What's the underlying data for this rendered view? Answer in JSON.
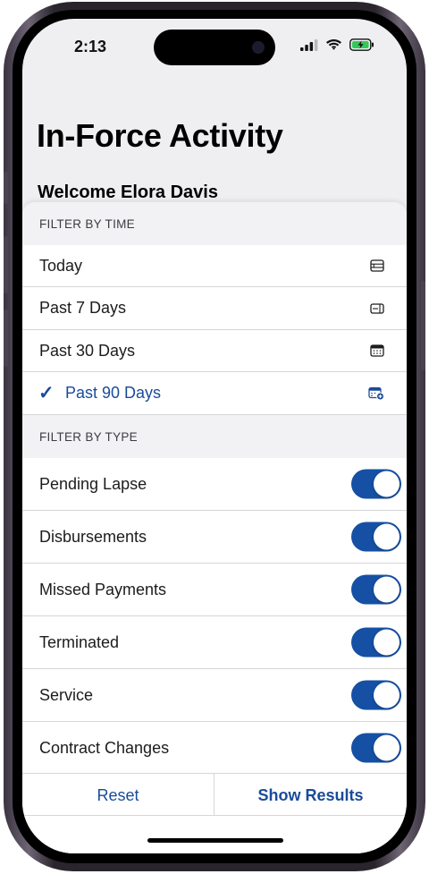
{
  "status_bar": {
    "time": "2:13"
  },
  "header": {
    "title": "In-Force Activity",
    "welcome": "Welcome Elora Davis"
  },
  "filter_time": {
    "header": "FILTER BY TIME",
    "items": [
      {
        "label": "Today",
        "icon": "calendar-day-icon",
        "selected": false
      },
      {
        "label": "Past 7 Days",
        "icon": "calendar-week-icon",
        "selected": false
      },
      {
        "label": "Past 30 Days",
        "icon": "calendar-month-icon",
        "selected": false
      },
      {
        "label": "Past 90 Days",
        "icon": "calendar-add-icon",
        "selected": true
      }
    ]
  },
  "filter_type": {
    "header": "FILTER BY TYPE",
    "items": [
      {
        "label": "Pending Lapse",
        "on": true
      },
      {
        "label": "Disbursements",
        "on": true
      },
      {
        "label": "Missed Payments",
        "on": true
      },
      {
        "label": "Terminated",
        "on": true
      },
      {
        "label": "Service",
        "on": true
      },
      {
        "label": "Contract Changes",
        "on": true
      }
    ]
  },
  "footer": {
    "reset_label": "Reset",
    "show_results_label": "Show Results"
  },
  "colors": {
    "accent": "#1a4b9a",
    "toggle_on": "#1550a4",
    "battery": "#34c759"
  }
}
